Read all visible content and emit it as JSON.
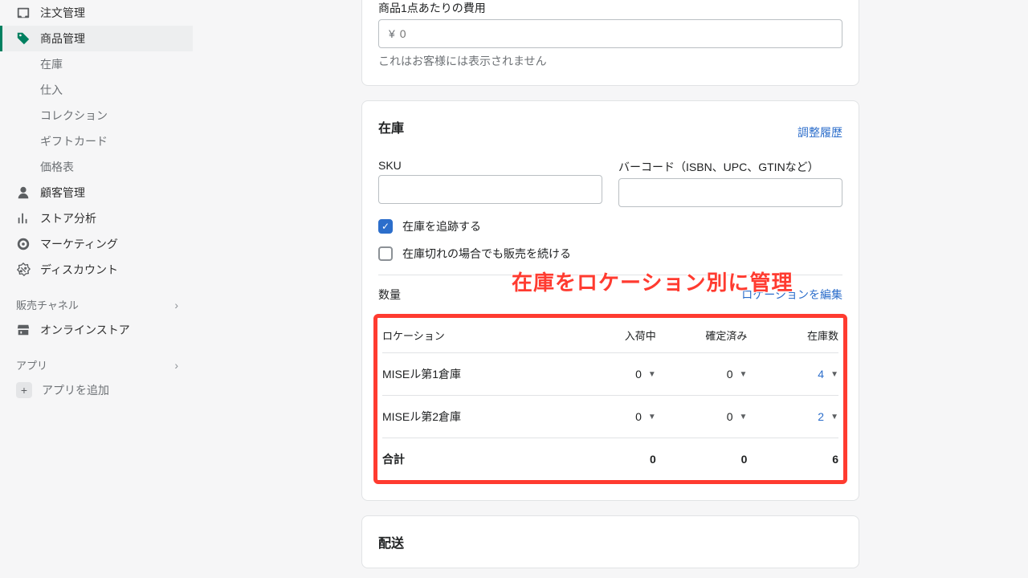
{
  "sidebar": {
    "items": [
      {
        "label": "注文管理",
        "icon": "inbox-icon"
      },
      {
        "label": "商品管理",
        "icon": "tag-icon"
      }
    ],
    "product_subs": [
      "在庫",
      "仕入",
      "コレクション",
      "ギフトカード",
      "価格表"
    ],
    "items2": [
      {
        "label": "顧客管理",
        "icon": "person-icon"
      },
      {
        "label": "ストア分析",
        "icon": "analytics-icon"
      },
      {
        "label": "マーケティング",
        "icon": "target-icon"
      },
      {
        "label": "ディスカウント",
        "icon": "discount-icon"
      }
    ],
    "channels_header": "販売チャネル",
    "channels": [
      {
        "label": "オンラインストア",
        "icon": "store-icon"
      }
    ],
    "apps_header": "アプリ",
    "add_app": "アプリを追加"
  },
  "cost": {
    "label": "商品1点あたりの費用",
    "currency": "¥",
    "placeholder": "0",
    "help": "これはお客様には表示されません"
  },
  "inventory": {
    "title": "在庫",
    "history_link": "調整履歴",
    "sku_label": "SKU",
    "barcode_label": "バーコード（ISBN、UPC、GTINなど）",
    "track_label": "在庫を追跡する",
    "oversell_label": "在庫切れの場合でも販売を続ける",
    "qty_title": "数量",
    "edit_locations": "ロケーションを編集",
    "columns": {
      "location": "ロケーション",
      "incoming": "入荷中",
      "committed": "確定済み",
      "available": "在庫数"
    },
    "rows": [
      {
        "location": "MISEル第1倉庫",
        "incoming": "0",
        "committed": "0",
        "available": "4"
      },
      {
        "location": "MISEル第2倉庫",
        "incoming": "0",
        "committed": "0",
        "available": "2"
      }
    ],
    "total": {
      "label": "合計",
      "incoming": "0",
      "committed": "0",
      "available": "6"
    }
  },
  "shipping": {
    "title": "配送"
  },
  "annotation": "在庫をロケーション別に管理"
}
